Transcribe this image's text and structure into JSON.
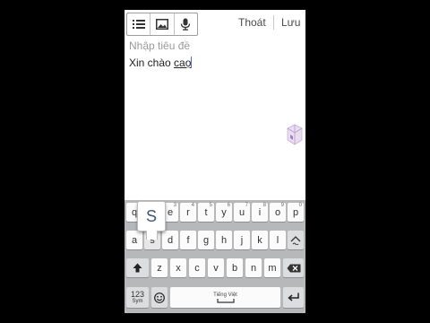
{
  "toolbar": {
    "icons": [
      "list-icon",
      "image-icon",
      "microphone-icon"
    ],
    "exit_label": "Thoát",
    "save_label": "Lưu"
  },
  "note": {
    "title_placeholder": "Nhập tiêu đề",
    "body_prefix": "Xin chào ",
    "body_composing": "caọ"
  },
  "keyboard": {
    "popup_letter": "S",
    "row1": [
      {
        "label": "q",
        "hint": "1"
      },
      {
        "label": "w",
        "hint": "2"
      },
      {
        "label": "e",
        "hint": "3"
      },
      {
        "label": "r",
        "hint": "4"
      },
      {
        "label": "t",
        "hint": "5"
      },
      {
        "label": "y",
        "hint": "6"
      },
      {
        "label": "u",
        "hint": "7"
      },
      {
        "label": "i",
        "hint": "8"
      },
      {
        "label": "o",
        "hint": "9"
      },
      {
        "label": "p",
        "hint": "0"
      }
    ],
    "row2": [
      "a",
      "s",
      "d",
      "f",
      "g",
      "h",
      "j",
      "k",
      "l"
    ],
    "row3": [
      "z",
      "x",
      "c",
      "v",
      "b",
      "n",
      "m"
    ],
    "sym_label": "123",
    "sym_sub": "Sym",
    "space_language": "Tiếng Việt",
    "icons": [
      "tone-mark-icon",
      "shift-icon",
      "backspace-icon",
      "emoji-icon",
      "enter-icon"
    ],
    "colors": {
      "keyboard_bg": "#b7b8ba",
      "key_bg": "#fbfbfb",
      "popup_text": "#3f5674"
    }
  }
}
